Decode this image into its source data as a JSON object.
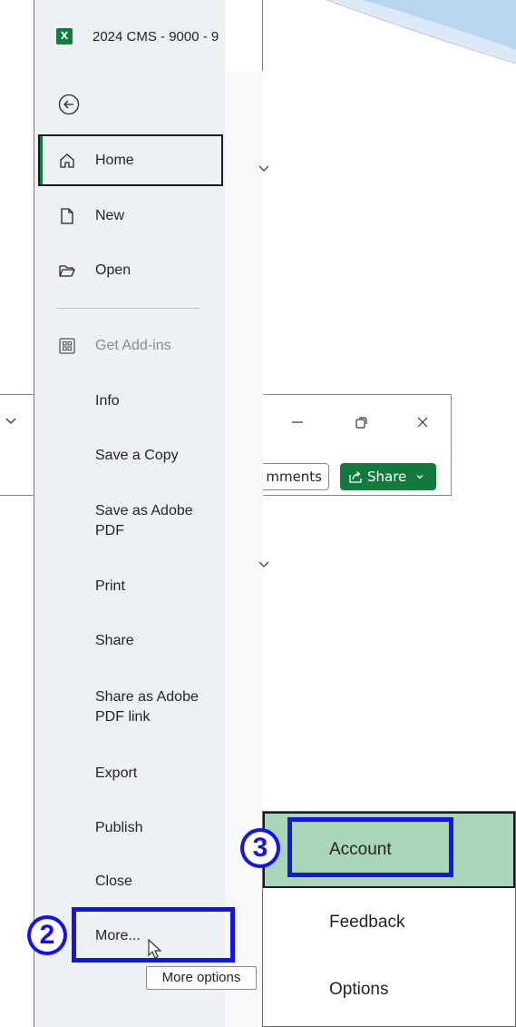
{
  "window": {
    "title": "2024 CMS - 9000 - 9",
    "app_icon_letter": "X",
    "accent_color": "#107c41"
  },
  "backstage": {
    "back_icon": "back-arrow-icon",
    "nav_items": [
      {
        "label": "Home",
        "icon": "home-icon",
        "selected": true
      },
      {
        "label": "New",
        "icon": "new-document-icon"
      },
      {
        "label": "Open",
        "icon": "folder-open-icon"
      },
      {
        "label": "Get Add-ins",
        "icon": "add-ins-icon",
        "disabled": true
      },
      {
        "label": "Info"
      },
      {
        "label": "Save a Copy"
      },
      {
        "label": "Save as Adobe\nPDF"
      },
      {
        "label": "Print"
      },
      {
        "label": "Share"
      },
      {
        "label": "Share as Adobe\nPDF link"
      },
      {
        "label": "Export"
      },
      {
        "label": "Publish"
      },
      {
        "label": "Close"
      },
      {
        "label": "More..."
      }
    ],
    "tooltip": "More options"
  },
  "background_window": {
    "comments_label": "mments",
    "share_label": "Share",
    "share_color": "#117a3c"
  },
  "submenu": {
    "items": [
      {
        "label": "Account",
        "highlighted": true
      },
      {
        "label": "Feedback"
      },
      {
        "label": "Options"
      }
    ],
    "highlight_color": "#a9d5b8"
  },
  "annotations": {
    "step_more": "2",
    "step_account": "3",
    "highlight_color": "#1414e6"
  }
}
